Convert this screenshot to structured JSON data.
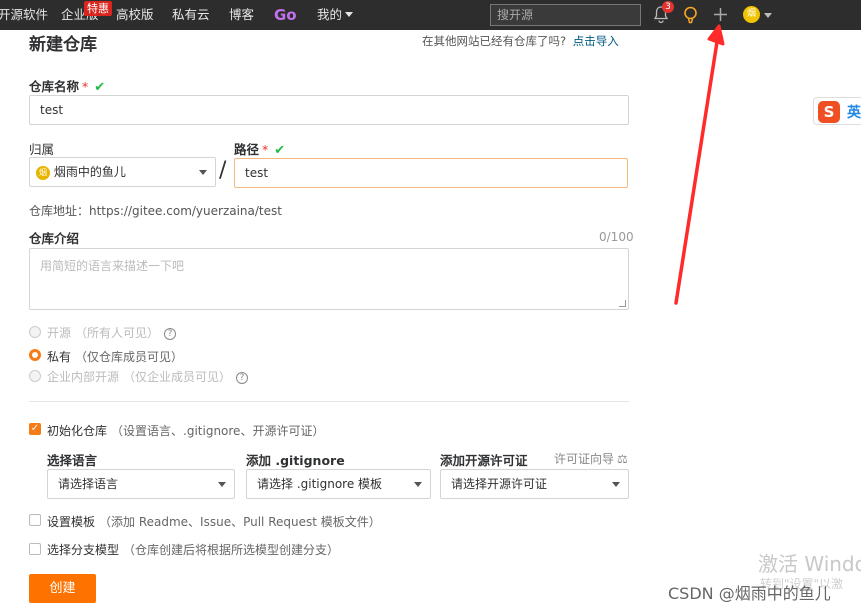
{
  "topbar": {
    "nav": [
      "开源软件",
      "企业版",
      "高校版",
      "私有云",
      "博客",
      "Go",
      "我的"
    ],
    "hot_badge": "特惠",
    "search_placeholder": "搜开源",
    "notification_count": "3",
    "avatar_letter": "烟"
  },
  "page": {
    "title": "新建仓库",
    "import_hint": "在其他网站已经有仓库了吗?",
    "import_link": "点击导入"
  },
  "form": {
    "name_label": "仓库名称",
    "required_mark": "*",
    "name_value": "test",
    "owner_label": "归属",
    "owner_value": "烟雨中的鱼儿",
    "owner_avatar_letter": "烟",
    "separator": "/",
    "path_label": "路径",
    "path_value": "test",
    "address": "仓库地址：https://gitee.com/yuerzaina/test",
    "intro_label": "仓库介绍",
    "intro_count": "0/100",
    "intro_placeholder": "用简短的语言来描述一下吧",
    "visibility": [
      {
        "label": "开源",
        "note": "（所有人可见）",
        "selected": false,
        "disabled": true
      },
      {
        "label": "私有",
        "note": "（仅仓库成员可见）",
        "selected": true,
        "disabled": false
      },
      {
        "label": "企业内部开源",
        "note": "（仅企业成员可见）",
        "selected": false,
        "disabled": true
      }
    ],
    "init_label": "初始化仓库",
    "init_note": "（设置语言、.gitignore、开源许可证）",
    "lang_label": "选择语言",
    "lang_value": "请选择语言",
    "gitignore_label": "添加 .gitignore",
    "gitignore_value": "请选择 .gitignore 模板",
    "license_label": "添加开源许可证",
    "license_guide": "许可证向导",
    "license_value": "请选择开源许可证",
    "template_label": "设置模板",
    "template_note": "（添加 Readme、Issue、Pull Request 模板文件）",
    "branch_label": "选择分支模型",
    "branch_note": "（仓库创建后将根据所选模型创建分支）",
    "create_button": "创建"
  },
  "ime_badge": "英",
  "watermark": {
    "activate": "激活 Windo",
    "activate_sub": "转到\"设置\"以激",
    "csdn": "CSDN @烟雨中的鱼儿"
  },
  "colors": {
    "accent": "#fe7300",
    "arrow": "#ff2a2a",
    "check": "#21ba45"
  }
}
